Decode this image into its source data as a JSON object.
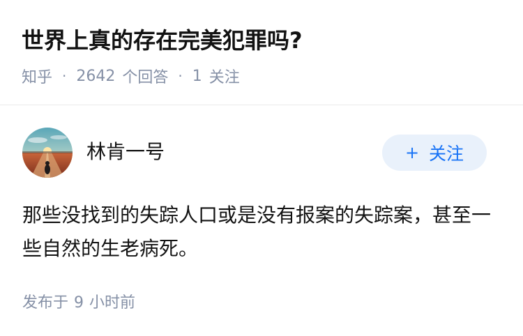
{
  "question": {
    "title": "世界上真的存在完美犯罪吗?",
    "source": "知乎",
    "answer_count": "2642",
    "answer_suffix": "个回答",
    "follower_count": "1",
    "follower_suffix": "关注",
    "separator": "·"
  },
  "answer": {
    "author_name": "林肯一号",
    "follow_button": {
      "icon": "+",
      "label": "关注"
    },
    "text": "那些没找到的失踪人口或是没有报案的失踪案，甚至一些自然的生老病死。",
    "publish_prefix": "发布于",
    "publish_number": "9",
    "publish_suffix": "小时前"
  },
  "colors": {
    "accent": "#1772f6",
    "follow_bg": "#e9f1fb",
    "meta": "#8590a6",
    "text": "#121212"
  }
}
